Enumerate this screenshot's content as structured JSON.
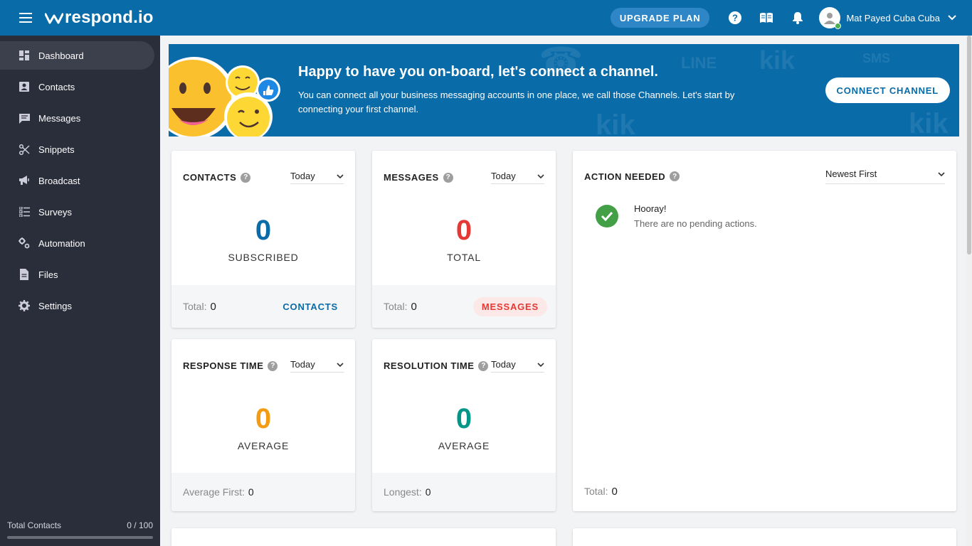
{
  "brand": {
    "logo_text": "respond.io",
    "primary_color": "#0a6ba9"
  },
  "topbar": {
    "upgrade_label": "UPGRADE PLAN",
    "icons": [
      "help-icon",
      "book-icon",
      "bell-icon"
    ],
    "user_name": "Mat Payed Cuba Cuba"
  },
  "sidebar": {
    "items": [
      {
        "label": "Dashboard",
        "icon": "dashboard-icon",
        "active": true
      },
      {
        "label": "Contacts",
        "icon": "contacts-icon"
      },
      {
        "label": "Messages",
        "icon": "messages-icon"
      },
      {
        "label": "Snippets",
        "icon": "scissors-icon"
      },
      {
        "label": "Broadcast",
        "icon": "megaphone-icon"
      },
      {
        "label": "Surveys",
        "icon": "list-icon"
      },
      {
        "label": "Automation",
        "icon": "automation-icon"
      },
      {
        "label": "Files",
        "icon": "file-icon"
      },
      {
        "label": "Settings",
        "icon": "gear-icon"
      }
    ],
    "total_contacts_label": "Total Contacts",
    "total_contacts_value": "0 / 100",
    "total_contacts_progress": 0
  },
  "banner": {
    "title": "Happy to have you on-board, let's connect a channel.",
    "text": "You can connect all your business messaging accounts in one place, we call those Channels. Let's start by connecting your first channel.",
    "button_label": "CONNECT CHANNEL"
  },
  "cards": {
    "contacts": {
      "title": "CONTACTS",
      "period": "Today",
      "value": "0",
      "sub": "SUBSCRIBED",
      "foot_label": "Total:",
      "foot_value": "0",
      "link": "CONTACTS",
      "value_color": "#0a6ba9"
    },
    "messages": {
      "title": "MESSAGES",
      "period": "Today",
      "value": "0",
      "sub": "TOTAL",
      "foot_label": "Total:",
      "foot_value": "0",
      "link": "MESSAGES",
      "value_color": "#e53935"
    },
    "response": {
      "title": "RESPONSE TIME",
      "period": "Today",
      "value": "0",
      "sub": "AVERAGE",
      "foot_label": "Average First:",
      "foot_value": "0",
      "value_color": "#f39c12"
    },
    "resolution": {
      "title": "RESOLUTION TIME",
      "period": "Today",
      "value": "0",
      "sub": "AVERAGE",
      "foot_label": "Longest:",
      "foot_value": "0",
      "value_color": "#009688"
    },
    "action": {
      "title": "ACTION NEEDED",
      "sort": "Newest First",
      "hooray": "Hooray!",
      "message": "There are no pending actions.",
      "foot_label": "Total:",
      "foot_value": "0"
    }
  }
}
